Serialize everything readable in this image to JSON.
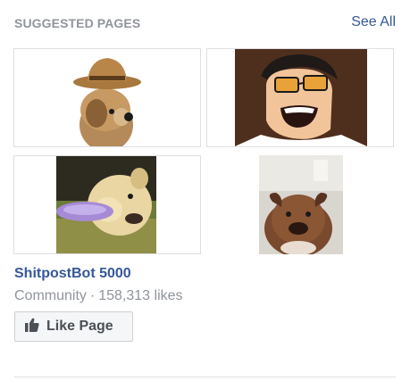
{
  "header": {
    "title": "SUGGESTED PAGES",
    "see_all": "See All"
  },
  "thumbnails": [
    {
      "name": "dog-in-cowboy-hat-photo"
    },
    {
      "name": "cartoon-man-sunglasses-laughing-image"
    },
    {
      "name": "dog-catching-frisbee-photo"
    },
    {
      "name": "dog-looking-up-photo"
    }
  ],
  "page": {
    "name": "ShitpostBot 5000",
    "category": "Community",
    "separator": "·",
    "likes": "158,313 likes"
  },
  "like_button": {
    "label": "Like Page",
    "icon": "thumbs-up-icon"
  },
  "colors": {
    "link": "#365899",
    "muted": "#90949c",
    "border": "#dddfe2",
    "button_bg": "#f5f6f7"
  }
}
